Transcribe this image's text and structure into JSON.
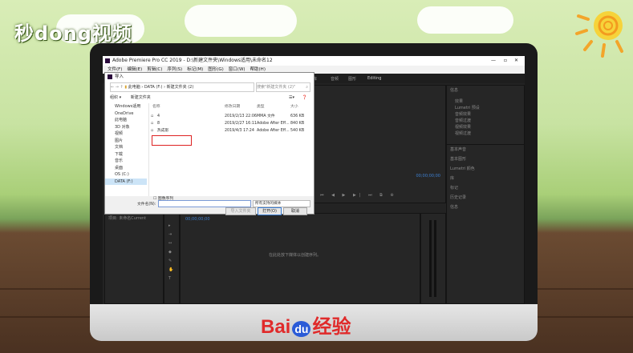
{
  "watermark": {
    "top_left": "秒dong视频",
    "brand_bai": "Bai",
    "brand_du": "du",
    "brand_cn": "经验"
  },
  "window": {
    "title": "Adobe Premiere Pro CC 2019 - D:\\新建文件夹\\Windows适用\\未命名12",
    "menu": [
      "文件(F)",
      "编辑(E)",
      "剪辑(C)",
      "序列(S)",
      "标记(M)",
      "图形(G)",
      "窗口(W)",
      "帮助(H)"
    ],
    "workspace_tabs": [
      "库",
      "音频",
      "图形",
      "Editing"
    ]
  },
  "panels": {
    "right_top": "信息",
    "right_tree": [
      "效果",
      "Lumetri 预设",
      "音频效果",
      "音频过渡",
      "视频效果",
      "视频过渡"
    ],
    "right_stack": [
      "基本声音",
      "基本图形",
      "Lumetri 颜色",
      "库",
      "标记",
      "历史记录",
      "信息"
    ],
    "project": "项目: 未命名Current",
    "timeline_placeholder": "在此处放下媒体以创建序列。",
    "timecode_a": "00;00;00;00",
    "timecode_b": "00;00;00;00"
  },
  "dialog": {
    "title": "导入",
    "breadcrumb": [
      "此电脑",
      "DATA (F:)",
      "新建文件夹 (2)"
    ],
    "search_placeholder": "搜索\"新建文件夹 (2)\"",
    "organize": "组织 ▾",
    "new_folder": "新建文件夹",
    "nav_items": [
      "Windows适用",
      "OneDrive",
      "此电脑",
      "3D 对象",
      "视频",
      "图片",
      "文档",
      "下载",
      "音乐",
      "桌面",
      "OS (C:)",
      "DATA (F:)"
    ],
    "columns": {
      "name": "名称",
      "date": "修改日期",
      "type": "类型",
      "size": "大小"
    },
    "files": [
      {
        "name": "4",
        "date": "2019/2/13 22:06",
        "type": "MMA 文件",
        "size": "636 KB"
      },
      {
        "name": "8",
        "date": "2019/2/27 16:11",
        "type": "Adobe After Eff...",
        "size": "840 KB"
      },
      {
        "name": "热成影",
        "date": "2019/4/3 17:24",
        "type": "Adobe After Eff...",
        "size": "540 KB"
      }
    ],
    "image_sequence": "图像序列",
    "filename_label": "文件名(N):",
    "filetype": "所有支持的媒体",
    "import_folder": "导入文件夹",
    "open": "打开(O)",
    "cancel": "取消"
  }
}
